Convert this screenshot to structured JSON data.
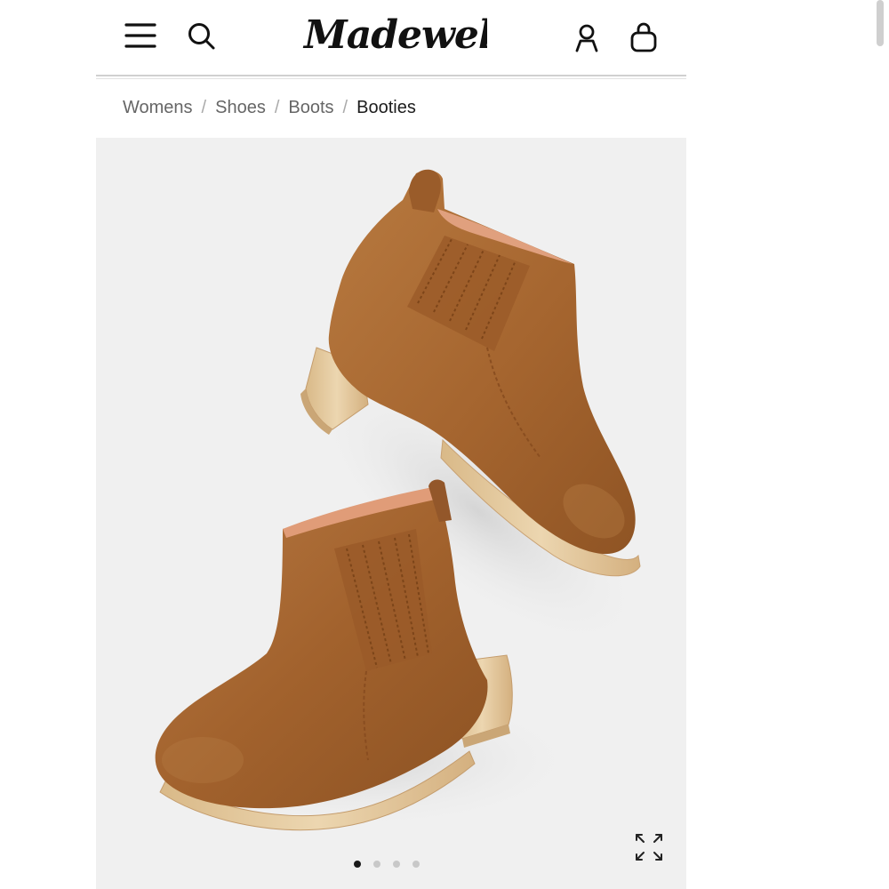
{
  "header": {
    "brand": "Madewell",
    "menu_icon": "hamburger-menu-icon",
    "search_icon": "search-icon",
    "account_icon": "user-account-icon",
    "bag_icon": "shopping-bag-icon"
  },
  "breadcrumb": {
    "items": [
      "Womens",
      "Shoes",
      "Boots"
    ],
    "separator": "/",
    "current": "Booties"
  },
  "gallery": {
    "slide_count": 4,
    "active_slide": 1,
    "expand_icon": "expand-arrows-icon",
    "background": "#f0f0f0"
  },
  "colors": {
    "suede": "#a86a34",
    "wood": "#e5c89d",
    "text_dark": "#1c1c1c",
    "text_muted": "#666666"
  }
}
